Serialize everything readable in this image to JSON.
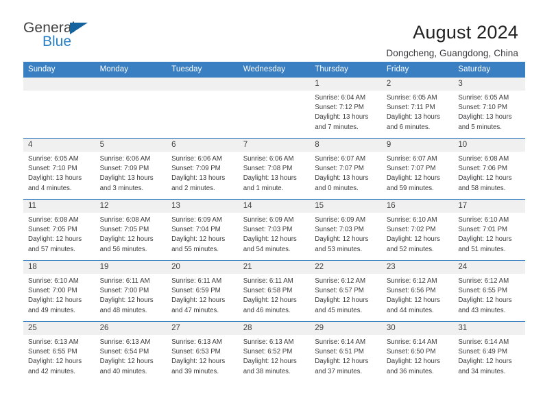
{
  "brand": {
    "word_one": "General",
    "word_two": "Blue",
    "triangle_icon": "triangle-icon",
    "colors": {
      "general": "#3f3f3f",
      "blue": "#2980c4",
      "triangle": "#15639f"
    }
  },
  "header": {
    "title": "August 2024",
    "subtitle": "Dongcheng, Guangdong, China"
  },
  "calendar": {
    "accent_color": "#3a7fc1",
    "daynum_band_color": "#f0f0f0",
    "weekday_headers": [
      "Sunday",
      "Monday",
      "Tuesday",
      "Wednesday",
      "Thursday",
      "Friday",
      "Saturday"
    ],
    "weeks": [
      [
        {
          "day": "",
          "lines": []
        },
        {
          "day": "",
          "lines": []
        },
        {
          "day": "",
          "lines": []
        },
        {
          "day": "",
          "lines": []
        },
        {
          "day": "1",
          "lines": [
            "Sunrise: 6:04 AM",
            "Sunset: 7:12 PM",
            "Daylight: 13 hours",
            "and 7 minutes."
          ]
        },
        {
          "day": "2",
          "lines": [
            "Sunrise: 6:05 AM",
            "Sunset: 7:11 PM",
            "Daylight: 13 hours",
            "and 6 minutes."
          ]
        },
        {
          "day": "3",
          "lines": [
            "Sunrise: 6:05 AM",
            "Sunset: 7:10 PM",
            "Daylight: 13 hours",
            "and 5 minutes."
          ]
        }
      ],
      [
        {
          "day": "4",
          "lines": [
            "Sunrise: 6:05 AM",
            "Sunset: 7:10 PM",
            "Daylight: 13 hours",
            "and 4 minutes."
          ]
        },
        {
          "day": "5",
          "lines": [
            "Sunrise: 6:06 AM",
            "Sunset: 7:09 PM",
            "Daylight: 13 hours",
            "and 3 minutes."
          ]
        },
        {
          "day": "6",
          "lines": [
            "Sunrise: 6:06 AM",
            "Sunset: 7:09 PM",
            "Daylight: 13 hours",
            "and 2 minutes."
          ]
        },
        {
          "day": "7",
          "lines": [
            "Sunrise: 6:06 AM",
            "Sunset: 7:08 PM",
            "Daylight: 13 hours",
            "and 1 minute."
          ]
        },
        {
          "day": "8",
          "lines": [
            "Sunrise: 6:07 AM",
            "Sunset: 7:07 PM",
            "Daylight: 13 hours",
            "and 0 minutes."
          ]
        },
        {
          "day": "9",
          "lines": [
            "Sunrise: 6:07 AM",
            "Sunset: 7:07 PM",
            "Daylight: 12 hours",
            "and 59 minutes."
          ]
        },
        {
          "day": "10",
          "lines": [
            "Sunrise: 6:08 AM",
            "Sunset: 7:06 PM",
            "Daylight: 12 hours",
            "and 58 minutes."
          ]
        }
      ],
      [
        {
          "day": "11",
          "lines": [
            "Sunrise: 6:08 AM",
            "Sunset: 7:05 PM",
            "Daylight: 12 hours",
            "and 57 minutes."
          ]
        },
        {
          "day": "12",
          "lines": [
            "Sunrise: 6:08 AM",
            "Sunset: 7:05 PM",
            "Daylight: 12 hours",
            "and 56 minutes."
          ]
        },
        {
          "day": "13",
          "lines": [
            "Sunrise: 6:09 AM",
            "Sunset: 7:04 PM",
            "Daylight: 12 hours",
            "and 55 minutes."
          ]
        },
        {
          "day": "14",
          "lines": [
            "Sunrise: 6:09 AM",
            "Sunset: 7:03 PM",
            "Daylight: 12 hours",
            "and 54 minutes."
          ]
        },
        {
          "day": "15",
          "lines": [
            "Sunrise: 6:09 AM",
            "Sunset: 7:03 PM",
            "Daylight: 12 hours",
            "and 53 minutes."
          ]
        },
        {
          "day": "16",
          "lines": [
            "Sunrise: 6:10 AM",
            "Sunset: 7:02 PM",
            "Daylight: 12 hours",
            "and 52 minutes."
          ]
        },
        {
          "day": "17",
          "lines": [
            "Sunrise: 6:10 AM",
            "Sunset: 7:01 PM",
            "Daylight: 12 hours",
            "and 51 minutes."
          ]
        }
      ],
      [
        {
          "day": "18",
          "lines": [
            "Sunrise: 6:10 AM",
            "Sunset: 7:00 PM",
            "Daylight: 12 hours",
            "and 49 minutes."
          ]
        },
        {
          "day": "19",
          "lines": [
            "Sunrise: 6:11 AM",
            "Sunset: 7:00 PM",
            "Daylight: 12 hours",
            "and 48 minutes."
          ]
        },
        {
          "day": "20",
          "lines": [
            "Sunrise: 6:11 AM",
            "Sunset: 6:59 PM",
            "Daylight: 12 hours",
            "and 47 minutes."
          ]
        },
        {
          "day": "21",
          "lines": [
            "Sunrise: 6:11 AM",
            "Sunset: 6:58 PM",
            "Daylight: 12 hours",
            "and 46 minutes."
          ]
        },
        {
          "day": "22",
          "lines": [
            "Sunrise: 6:12 AM",
            "Sunset: 6:57 PM",
            "Daylight: 12 hours",
            "and 45 minutes."
          ]
        },
        {
          "day": "23",
          "lines": [
            "Sunrise: 6:12 AM",
            "Sunset: 6:56 PM",
            "Daylight: 12 hours",
            "and 44 minutes."
          ]
        },
        {
          "day": "24",
          "lines": [
            "Sunrise: 6:12 AM",
            "Sunset: 6:55 PM",
            "Daylight: 12 hours",
            "and 43 minutes."
          ]
        }
      ],
      [
        {
          "day": "25",
          "lines": [
            "Sunrise: 6:13 AM",
            "Sunset: 6:55 PM",
            "Daylight: 12 hours",
            "and 42 minutes."
          ]
        },
        {
          "day": "26",
          "lines": [
            "Sunrise: 6:13 AM",
            "Sunset: 6:54 PM",
            "Daylight: 12 hours",
            "and 40 minutes."
          ]
        },
        {
          "day": "27",
          "lines": [
            "Sunrise: 6:13 AM",
            "Sunset: 6:53 PM",
            "Daylight: 12 hours",
            "and 39 minutes."
          ]
        },
        {
          "day": "28",
          "lines": [
            "Sunrise: 6:13 AM",
            "Sunset: 6:52 PM",
            "Daylight: 12 hours",
            "and 38 minutes."
          ]
        },
        {
          "day": "29",
          "lines": [
            "Sunrise: 6:14 AM",
            "Sunset: 6:51 PM",
            "Daylight: 12 hours",
            "and 37 minutes."
          ]
        },
        {
          "day": "30",
          "lines": [
            "Sunrise: 6:14 AM",
            "Sunset: 6:50 PM",
            "Daylight: 12 hours",
            "and 36 minutes."
          ]
        },
        {
          "day": "31",
          "lines": [
            "Sunrise: 6:14 AM",
            "Sunset: 6:49 PM",
            "Daylight: 12 hours",
            "and 34 minutes."
          ]
        }
      ]
    ]
  }
}
